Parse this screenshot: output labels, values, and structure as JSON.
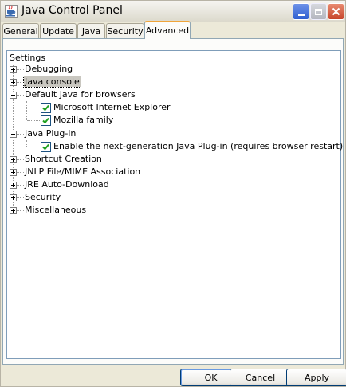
{
  "window": {
    "title": "Java Control Panel"
  },
  "tabs": [
    {
      "label": "General"
    },
    {
      "label": "Update"
    },
    {
      "label": "Java"
    },
    {
      "label": "Security"
    },
    {
      "label": "Advanced",
      "active": true
    }
  ],
  "tree": {
    "root_label": "Settings",
    "nodes": [
      {
        "label": "Debugging",
        "state": "collapsed"
      },
      {
        "label": "Java console",
        "state": "collapsed",
        "selected": true
      },
      {
        "label": "Default Java for browsers",
        "state": "expanded",
        "children": [
          {
            "label": "Microsoft Internet Explorer",
            "checked": true
          },
          {
            "label": "Mozilla family",
            "checked": true
          }
        ]
      },
      {
        "label": "Java Plug-in",
        "state": "expanded",
        "children": [
          {
            "label": "Enable the next-generation Java Plug-in (requires browser restart)",
            "checked": true
          }
        ]
      },
      {
        "label": "Shortcut Creation",
        "state": "collapsed"
      },
      {
        "label": "JNLP File/MIME Association",
        "state": "collapsed"
      },
      {
        "label": "JRE Auto-Download",
        "state": "collapsed"
      },
      {
        "label": "Security",
        "state": "collapsed"
      },
      {
        "label": "Miscellaneous",
        "state": "collapsed"
      }
    ]
  },
  "buttons": {
    "ok": "OK",
    "cancel": "Cancel",
    "apply": "Apply"
  },
  "colors": {
    "tab_active_accent": "#f0a53b",
    "checkmark": "#21a121",
    "focus_border": "#003c74"
  }
}
